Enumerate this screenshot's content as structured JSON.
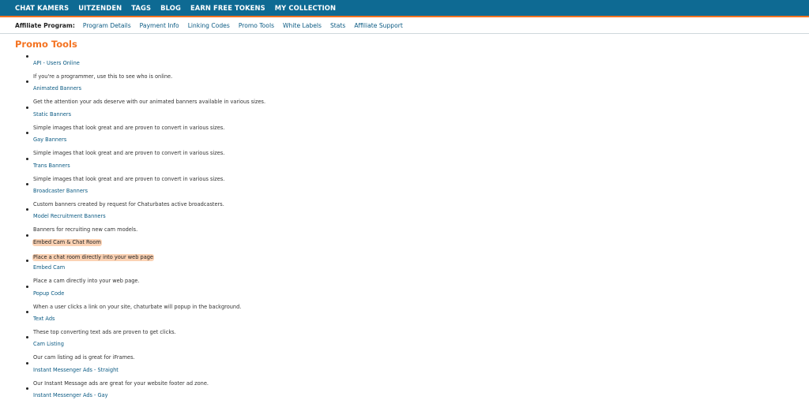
{
  "topnav": {
    "items": [
      "CHAT KAMERS",
      "UITZENDEN",
      "TAGS",
      "BLOG",
      "EARN FREE TOKENS",
      "MY COLLECTION"
    ]
  },
  "subnav": {
    "label": "Affiliate Program:",
    "items": [
      "Program Details",
      "Payment Info",
      "Linking Codes",
      "Promo Tools",
      "White Labels",
      "Stats",
      "Affiliate Support"
    ]
  },
  "page": {
    "title": "Promo Tools"
  },
  "tools": [
    {
      "title": "API - Users Online",
      "desc": "If you're a programmer, use this to see who is online."
    },
    {
      "title": "Animated Banners",
      "desc": "Get the attention your ads deserve with our animated banners available in various sizes."
    },
    {
      "title": "Static Banners",
      "desc": "Simple images that look great and are proven to convert in various sizes."
    },
    {
      "title": "Gay Banners",
      "desc": "Simple images that look great and are proven to convert in various sizes."
    },
    {
      "title": "Trans Banners",
      "desc": "Simple images that look great and are proven to convert in various sizes."
    },
    {
      "title": "Broadcaster Banners",
      "desc": "Custom banners created by request for Chaturbates active broadcasters."
    },
    {
      "title": "Model Recruitment Banners",
      "desc": "Banners for recruiting new cam models."
    },
    {
      "title": "Embed Cam & Chat Room",
      "desc": "Place a chat room directly into your web page"
    },
    {
      "title": "Embed Cam",
      "desc": "Place a cam directly into your web page."
    },
    {
      "title": "Popup Code",
      "desc": "When a user clicks a link on your site, chaturbate will popup in the background."
    },
    {
      "title": "Text Ads",
      "desc": "These top converting text ads are proven to get clicks."
    },
    {
      "title": "Cam Listing",
      "desc": "Our cam listing ad is great for iFrames."
    },
    {
      "title": "Instant Messenger Ads - Straight",
      "desc": "Our Instant Message ads are great for your website footer ad zone."
    },
    {
      "title": "Instant Messenger Ads - Gay",
      "desc": ""
    }
  ]
}
